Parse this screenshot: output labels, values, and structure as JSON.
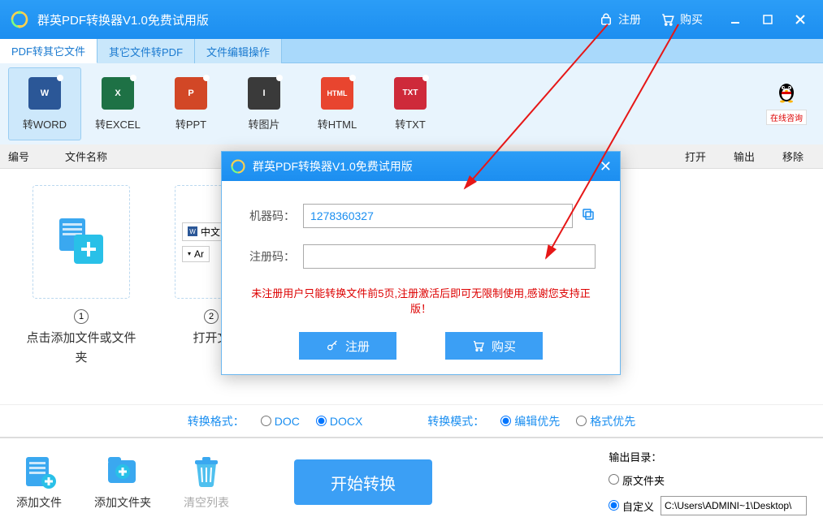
{
  "titlebar": {
    "title": "群英PDF转换器V1.0免费试用版",
    "register": "注册",
    "buy": "购买"
  },
  "tabs": [
    {
      "label": "PDF转其它文件",
      "active": true
    },
    {
      "label": "其它文件转PDF",
      "active": false
    },
    {
      "label": "文件编辑操作",
      "active": false
    }
  ],
  "tools": [
    {
      "label": "转WORD",
      "icon": "W",
      "cls": "word",
      "active": true
    },
    {
      "label": "转EXCEL",
      "icon": "X",
      "cls": "excel"
    },
    {
      "label": "转PPT",
      "icon": "P",
      "cls": "ppt"
    },
    {
      "label": "转图片",
      "icon": "I",
      "cls": "img"
    },
    {
      "label": "转HTML",
      "icon": "HTML",
      "cls": "html"
    },
    {
      "label": "转TXT",
      "icon": "TXT",
      "cls": "txt"
    }
  ],
  "qq_consult": "在线咨询",
  "columns": {
    "id": "编号",
    "filename": "文件名称",
    "open": "打开",
    "output": "输出",
    "remove": "移除"
  },
  "placeholders": {
    "step1_num": "1",
    "step1": "点击添加文件或文件夹",
    "step2_num": "2",
    "step2_partial": "打开文"
  },
  "preview_file": "中文",
  "preview_font": "Ar",
  "radios": {
    "format_label": "转换格式：",
    "doc": "DOC",
    "docx": "DOCX",
    "mode_label": "转换模式：",
    "edit": "编辑优先",
    "format": "格式优先"
  },
  "bottom": {
    "add_file": "添加文件",
    "add_folder": "添加文件夹",
    "clear": "清空列表",
    "start": "开始转换",
    "out_label": "输出目录：",
    "orig": "原文件夹",
    "custom": "自定义",
    "path": "C:\\Users\\ADMINI~1\\Desktop\\"
  },
  "modal": {
    "title": "群英PDF转换器V1.0免费试用版",
    "machine_label": "机器码：",
    "machine_code": "1278360327",
    "reg_label": "注册码：",
    "reg_code": "",
    "note": "未注册用户只能转换文件前5页,注册激活后即可无限制使用,感谢您支持正版！",
    "register_btn": "注册",
    "buy_btn": "购买"
  }
}
